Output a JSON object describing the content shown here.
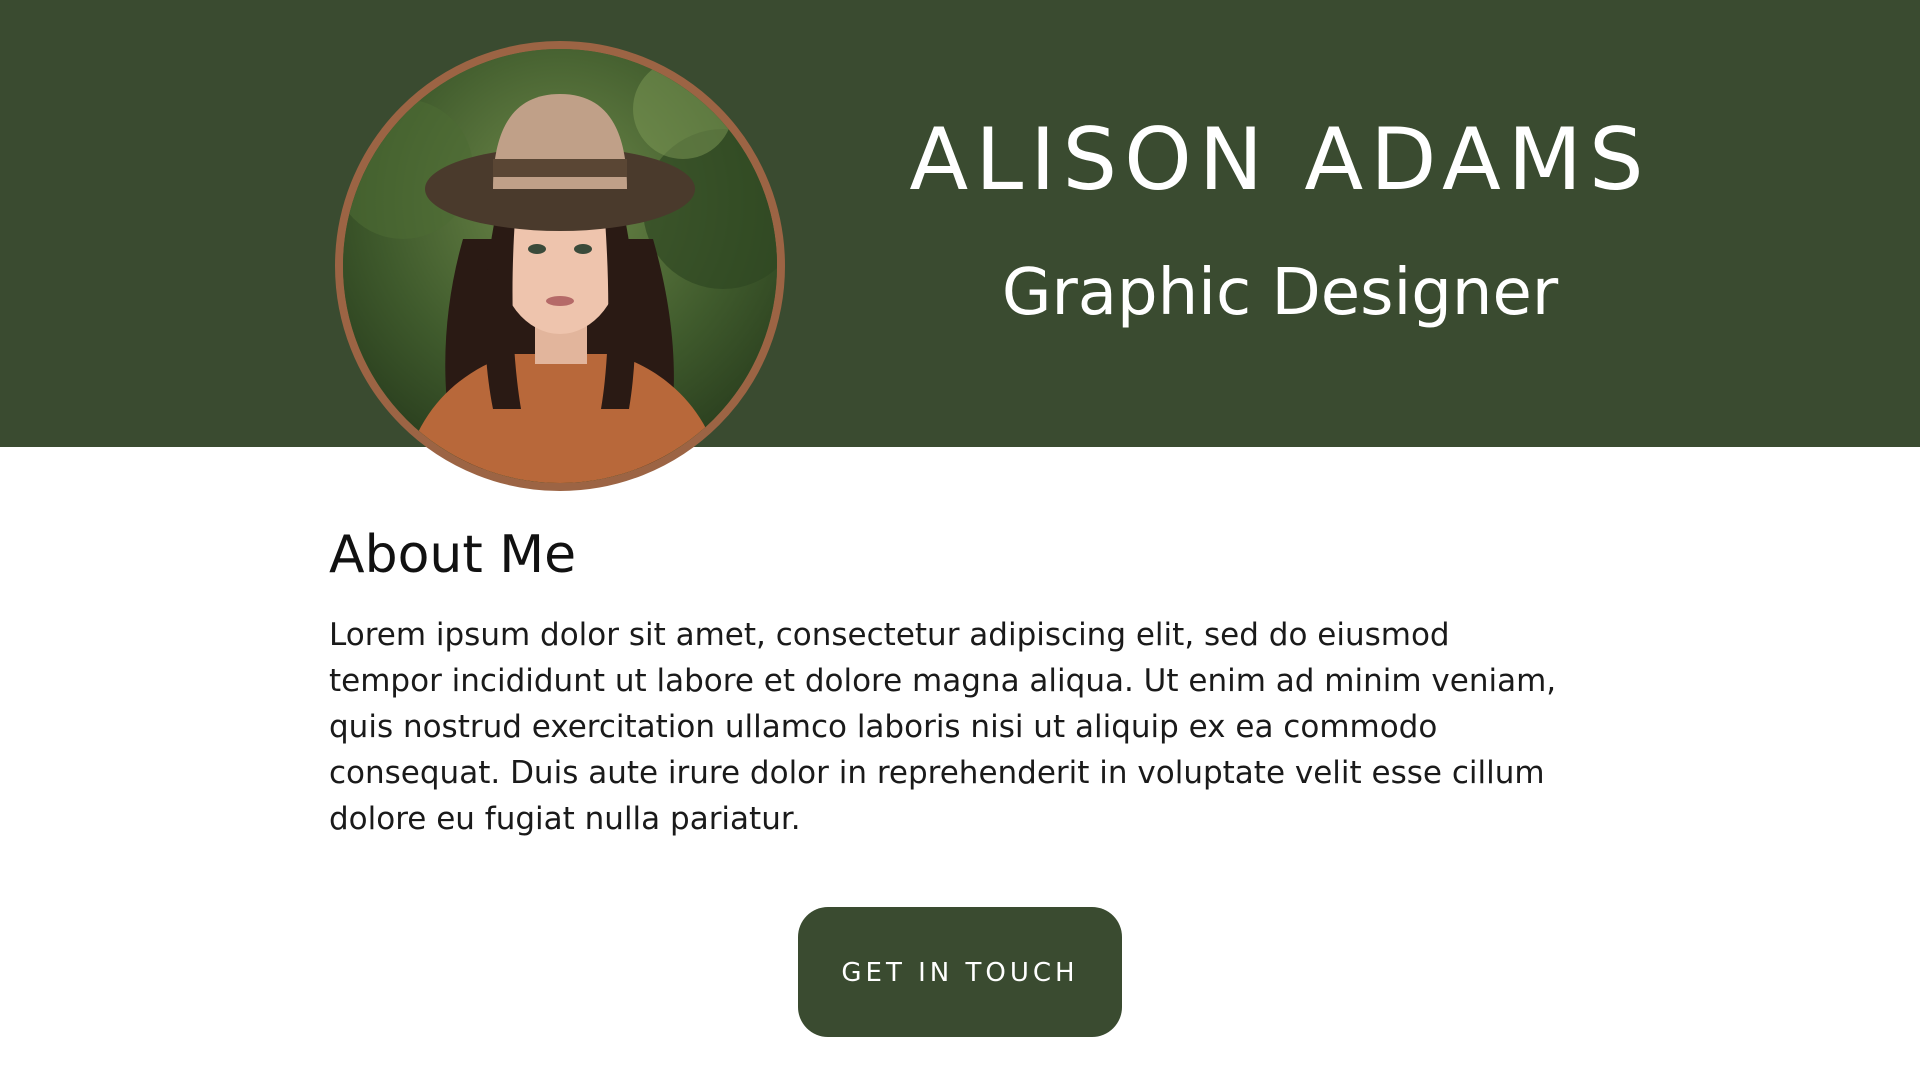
{
  "header": {
    "name": "ALISON ADAMS",
    "role": "Graphic Designer",
    "band_color": "#3a4b30"
  },
  "avatar": {
    "icon": "profile-photo",
    "ring_color": "#9c6444"
  },
  "about": {
    "title": "About Me",
    "body": "Lorem ipsum dolor sit amet, consectetur adipiscing elit, sed do eiusmod tempor incididunt ut labore et dolore magna aliqua. Ut enim ad minim veniam, quis nostrud exercitation ullamco laboris nisi ut aliquip ex ea commodo consequat. Duis aute irure dolor in reprehenderit in voluptate velit esse cillum dolore eu fugiat nulla pariatur."
  },
  "cta": {
    "label": "GET IN TOUCH",
    "color": "#3a4b30"
  }
}
